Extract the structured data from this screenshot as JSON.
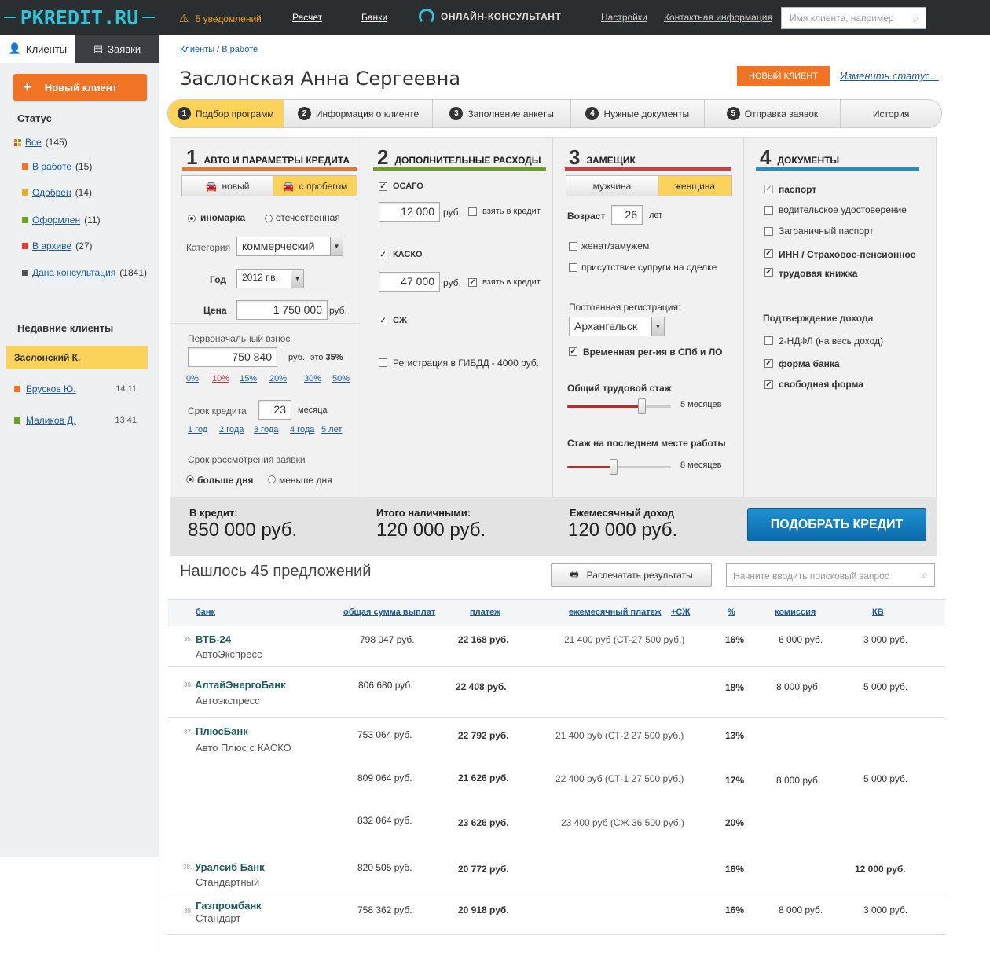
{
  "header": {
    "logo": "PKREDIT.RU",
    "notifications": "5 уведомлений",
    "nav": [
      "Расчет",
      "Банки"
    ],
    "consultant": "ОНЛАЙН-КОНСУЛЬТАНТ",
    "settings": "Настройки",
    "contacts": "Контактная информация",
    "search_placeholder": "Имя клиента, например"
  },
  "sidebar": {
    "tabs": [
      "Клиенты",
      "Заявки"
    ],
    "new_client": "Новый клиент",
    "status_title": "Статус",
    "statuses": [
      {
        "label": "Все",
        "count": "(145)",
        "color": "multi"
      },
      {
        "label": "В работе",
        "count": "(15)",
        "color": "#f07423"
      },
      {
        "label": "Одобрен",
        "count": "(14)",
        "color": "#e9b31a"
      },
      {
        "label": "Оформлен",
        "count": "(11)",
        "color": "#6aa121"
      },
      {
        "label": "В архиве",
        "count": "(27)",
        "color": "#e33b3b"
      },
      {
        "label": "Дана консультация",
        "count": "(1841)",
        "color": "#555555"
      }
    ],
    "recent_title": "Недавние клиенты",
    "recent": [
      {
        "name": "Заслонский К.",
        "time": "",
        "color": "#f07423"
      },
      {
        "name": "Брусков Ю.",
        "time": "14:11",
        "color": "#f07423"
      },
      {
        "name": "Маликов Д.",
        "time": "13:41",
        "color": "#6aa121"
      }
    ]
  },
  "page": {
    "breadcrumbs": [
      "Клиенты",
      "В работе"
    ],
    "client_name": "Заслонская Анна Сергеевна",
    "badge": "НОВЫЙ КЛИЕНТ",
    "change_status": "Изменить статус...",
    "steps": [
      {
        "n": "1",
        "label": "Подбор программ"
      },
      {
        "n": "2",
        "label": "Информация о клиенте"
      },
      {
        "n": "3",
        "label": "Заполнение анкеты"
      },
      {
        "n": "4",
        "label": "Нужные документы"
      },
      {
        "n": "5",
        "label": "Отправка заявок"
      },
      {
        "n": "",
        "label": "История"
      }
    ]
  },
  "form": {
    "c1": {
      "num": "1",
      "title": "АВТО И ПАРАМЕТРЫ КРЕДИТА",
      "toggle": [
        "новый",
        "с пробегом"
      ],
      "origin": [
        "иномарка",
        "отечественная"
      ],
      "category_label": "Категория",
      "category": "коммерческий",
      "year_label": "Год",
      "year": "2012 г.в.",
      "price_label": "Цена",
      "price": "1 750 000",
      "rub": "руб.",
      "down_label": "Первоначальный взнос",
      "down": "750 840",
      "down_rub": "руб.",
      "down_pct_prefix": "это",
      "down_pct": "35%",
      "pcts": [
        "0%",
        "10%",
        "15%",
        "20%",
        "30%",
        "50%"
      ],
      "term_label": "Срок кредита",
      "term": "23",
      "term_unit": "месяца",
      "terms": [
        "1 год",
        "2 года",
        "3 года",
        "4 года",
        "5 лет"
      ],
      "review_label": "Срок рассмотрения заявки",
      "review": [
        "больше дня",
        "меньше дня"
      ]
    },
    "c2": {
      "num": "2",
      "title": "ДОПОЛНИТЕЛЬНЫЕ РАСХОДЫ",
      "osago": "ОСАГО",
      "osago_val": "12 000",
      "rub": "руб.",
      "credit": "взять в кредит",
      "kasko": "КАСКО",
      "kasko_val": "47 000",
      "szh": "СЖ",
      "gibdd": "Регистрация в ГИБДД - 4000 руб."
    },
    "c3": {
      "num": "3",
      "title": "ЗАМЕЩИК",
      "toggle": [
        "мужчина",
        "женщина"
      ],
      "age_label": "Возраст",
      "age": "26",
      "age_unit": "лет",
      "married": "женат/замужем",
      "spouse": "присутствие супруги на сделке",
      "reg_label": "Постоянная регистрация:",
      "reg": "Архангельск",
      "temp_reg": "Временная рег-ия в СПб и ЛО",
      "exp_label": "Общий трудовой стаж",
      "exp": "5 месяцев",
      "exp_frac": 0.72,
      "last_label": "Стаж на последнем месте работы",
      "last": "8 месяцев",
      "last_frac": 0.45
    },
    "c4": {
      "num": "4",
      "title": "ДОКУМЕНТЫ",
      "docs": [
        {
          "label": "паспорт",
          "checked": "gray",
          "bold": true
        },
        {
          "label": "водительское удостоверение",
          "checked": "no",
          "bold": false
        },
        {
          "label": "Заграничный паспорт",
          "checked": "no",
          "bold": false
        },
        {
          "label": "ИНН / Страховое-пенсионное",
          "checked": "yes",
          "bold": true
        },
        {
          "label": "трудовая книжка",
          "checked": "yes",
          "bold": true
        }
      ],
      "income_label": "Подтверждение дохода",
      "income": [
        {
          "label": "2-НДФЛ (на весь доход)",
          "checked": "no",
          "bold": false
        },
        {
          "label": "форма банка",
          "checked": "yes",
          "bold": true
        },
        {
          "label": "свободная форма",
          "checked": "yes",
          "bold": true
        }
      ]
    },
    "totals": {
      "credit_label": "В кредит:",
      "credit": "850 000 руб.",
      "cash_label": "Итого наличными:",
      "cash": "120 000 руб.",
      "income_label": "Ежемесячный доход",
      "income": "120 000 руб.",
      "button": "ПОДОБРАТЬ КРЕДИТ"
    }
  },
  "results": {
    "found": "Нашлось 45 предложений",
    "print": "Распечатать результаты",
    "search_placeholder": "Начните вводить поисковый запрос",
    "columns": [
      "банк",
      "общая сумма выплат",
      "платеж",
      "ежемесячный платеж",
      "+СЖ",
      "%",
      "комиссия",
      "КВ"
    ],
    "rows": [
      {
        "idx": "35.",
        "bank": "ВТБ-24",
        "program": "АвтоЭкспресс",
        "total": "798 047 руб.",
        "payment": "22 168 руб.",
        "monthly": "21 400 руб (СТ-27 500 руб.)",
        "pct": "16%",
        "commission": "6 000 руб.",
        "kv": "3 000 руб."
      },
      {
        "idx": "36.",
        "bank": "АлтайЭнергоБанк",
        "program": "Автоэкспресс",
        "total": "806 680 руб.",
        "payment": "22 408 руб.",
        "monthly": "",
        "pct": "18%",
        "commission": "8 000 руб.",
        "kv": "5 000 руб."
      },
      {
        "idx": "37.",
        "bank": "ПлюсБанк",
        "program": "Авто Плюс с КАСКО",
        "total": "753 064 руб.",
        "payment": "22 792 руб.",
        "monthly": "21 400 руб (СТ-2 27 500 руб.)",
        "pct": "13%",
        "commission": "",
        "kv": ""
      },
      {
        "idx": "",
        "bank": "",
        "program": "",
        "total": "809 064 руб.",
        "payment": "21 626 руб.",
        "monthly": "22 400 руб (СТ-1 27 500 руб.)",
        "pct": "17%",
        "commission": "8 000 руб.",
        "kv": "5 000 руб."
      },
      {
        "idx": "",
        "bank": "",
        "program": "",
        "total": "832 064 руб.",
        "payment": "23 626 руб.",
        "monthly": "23 400 руб (СЖ 36 500 руб.)",
        "pct": "20%",
        "commission": "",
        "kv": ""
      },
      {
        "idx": "38.",
        "bank": "Уралсиб Банк",
        "program": "Стандартный",
        "total": "820 505 руб.",
        "payment": "20 772 руб.",
        "monthly": "",
        "pct": "16%",
        "commission": "",
        "kv": "12 000 руб."
      },
      {
        "idx": "39.",
        "bank": "Газпромбанк",
        "program": "Стандарт",
        "total": "758 362 руб.",
        "payment": "20 918 руб.",
        "monthly": "",
        "pct": "16%",
        "commission": "8 000 руб.",
        "kv": "3 000 руб."
      }
    ]
  }
}
